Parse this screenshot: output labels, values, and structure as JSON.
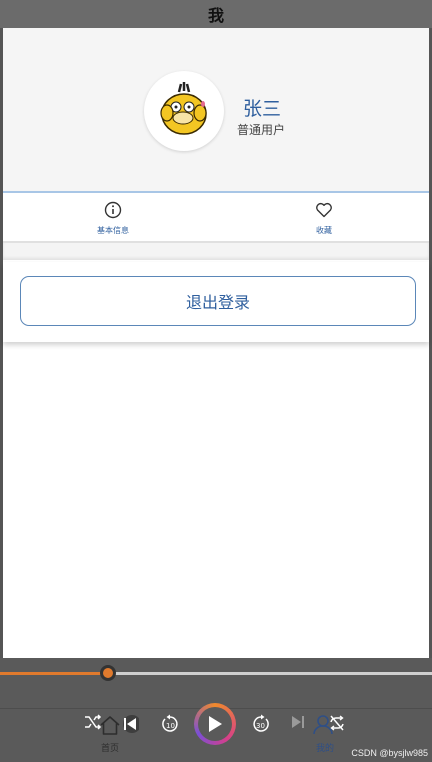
{
  "header": {
    "title": "我"
  },
  "profile": {
    "name": "张三",
    "role": "普通用户",
    "avatar_icon": "psyduck-avatar-icon"
  },
  "menu": {
    "items": [
      {
        "label": "基本信息",
        "icon": "info-icon"
      },
      {
        "label": "收藏",
        "icon": "heart-icon"
      }
    ]
  },
  "logout": {
    "label": "退出登录"
  },
  "player": {
    "progress_fraction": 0.25,
    "accent_color": "#e07a2d",
    "controls": [
      "shuffle-icon",
      "skip-previous-icon",
      "rewind-10-icon",
      "play-icon",
      "forward-30-icon",
      "skip-next-icon",
      "repeat-off-icon"
    ],
    "rewind_label": "10",
    "forward_label": "30"
  },
  "tabs": [
    {
      "label": "首页",
      "icon": "home-icon"
    },
    {
      "label": "我的",
      "icon": "profile-icon"
    }
  ],
  "watermark": "CSDN @bysjlw985"
}
